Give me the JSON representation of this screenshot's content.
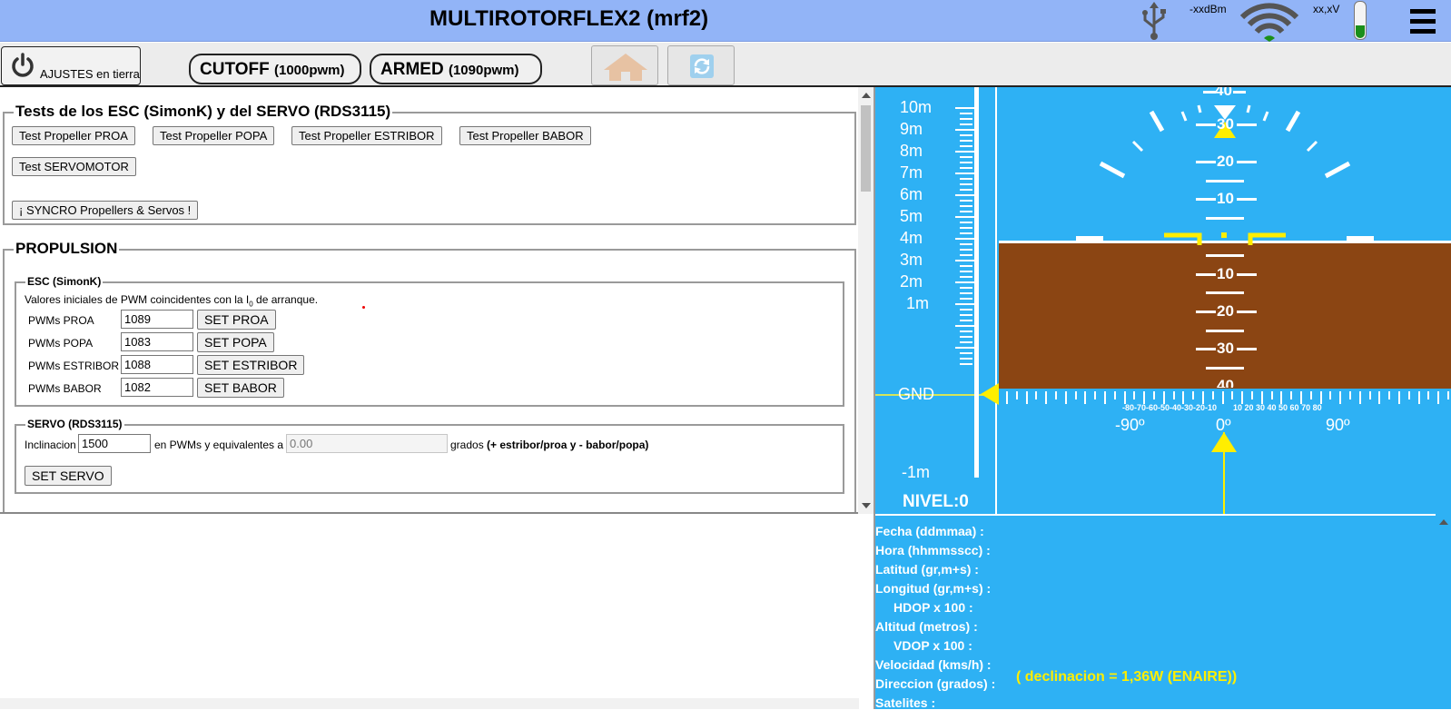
{
  "header": {
    "title": "MULTIROTORFLEX2 (mrf2)",
    "rssi": "-xxdBm",
    "voltage": "xx,xV",
    "battery_level": 0.35,
    "icons": [
      "usb-icon",
      "wifi-icon",
      "battery-icon",
      "menu-icon"
    ]
  },
  "toolbar": {
    "ajustes_label": "AJUSTES en tierra",
    "cutoff_label": "CUTOFF",
    "cutoff_value": "(1000pwm)",
    "armed_label": "ARMED",
    "armed_value": "(1090pwm)",
    "icons": [
      "power-icon",
      "home-icon",
      "refresh-icon"
    ]
  },
  "tests": {
    "legend": "Tests de los ESC (SimonK) y del SERVO (RDS3115)",
    "buttons": [
      "Test Propeller PROA",
      "Test Propeller POPA",
      "Test Propeller ESTRIBOR",
      "Test Propeller BABOR",
      "Test SERVOMOTOR",
      "¡ SYNCRO Propellers  & Servos !"
    ]
  },
  "propulsion": {
    "legend": "PROPULSION",
    "esc": {
      "legend": "ESC (SimonK)",
      "description_pre": "Valores iniciales de PWM coincidentes con la I",
      "description_sub": "0",
      "description_post": " de arranque.",
      "rows": [
        {
          "label": "PWMs PROA",
          "value": "1089",
          "button": "SET PROA"
        },
        {
          "label": "PWMs POPA",
          "value": "1083",
          "button": "SET POPA"
        },
        {
          "label": "PWMs ESTRIBOR",
          "value": "1088",
          "button": "SET ESTRIBOR"
        },
        {
          "label": "PWMs BABOR",
          "value": "1082",
          "button": "SET BABOR"
        }
      ]
    },
    "servo": {
      "legend": "SERVO (RDS3115)",
      "inclinacion_label": "Inclinacion",
      "inclinacion_value": "1500",
      "middle_text": "en PWMs y equivalentes a",
      "grados_value": "0.00",
      "grados_label": "grados",
      "grados_note": "(+ estribor/proa y - babor/popa)",
      "set_button": "SET SERVO"
    }
  },
  "instrument": {
    "altitude_labels": [
      "10m",
      "9m",
      "8m",
      "7m",
      "6m",
      "5m",
      "4m",
      "3m",
      "2m",
      "1m",
      "GND",
      "-1m"
    ],
    "nivel": "NIVEL:0",
    "pitch_up": [
      "40",
      "30",
      "20",
      "10"
    ],
    "pitch_down": [
      "10",
      "20",
      "30",
      "40"
    ],
    "roll_small": "-80-70-60-50-40-30-20-10",
    "roll_small_right": "10 20 30 40 50 60 70 80",
    "roll_left": "-90º",
    "roll_center": "0º",
    "roll_right": "90º",
    "colors": {
      "sky": "#2eb1f4",
      "ground": "#8b4513",
      "indicator": "#ffee00"
    }
  },
  "gps": {
    "fields": [
      "Fecha (ddmmaa) :",
      "Hora (hhmmsscc) :",
      "Latitud (gr,m+s) :",
      "Longitud (gr,m+s) :",
      "HDOP x 100 :",
      "Altitud (metros) :",
      "VDOP x 100 :",
      "Velocidad (kms/h) :",
      "Direccion (grados) :",
      "Satelites :"
    ],
    "declinacion": "( declinacion = 1,36W (ENAIRE))"
  }
}
